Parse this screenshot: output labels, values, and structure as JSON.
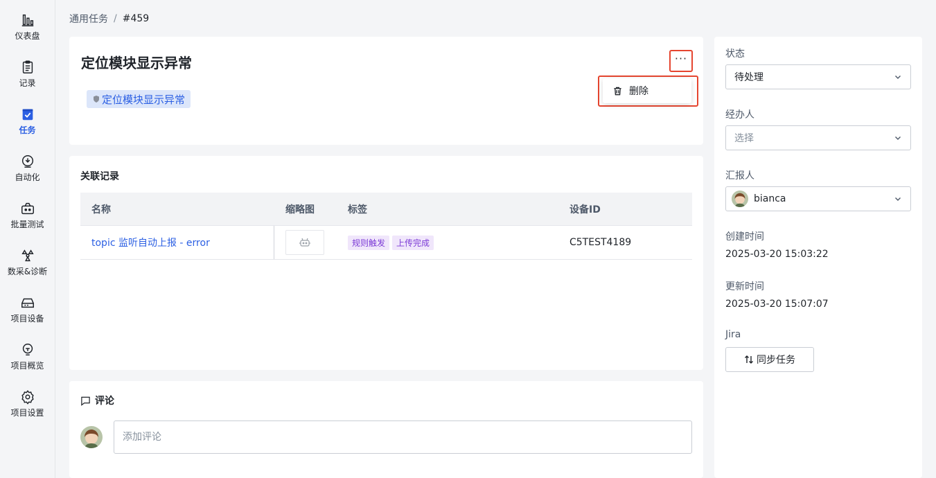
{
  "sidebar": {
    "items": [
      {
        "label": "仪表盘",
        "icon": "bar-chart-icon"
      },
      {
        "label": "记录",
        "icon": "clipboard-icon"
      },
      {
        "label": "任务",
        "icon": "task-check-icon",
        "active": true
      },
      {
        "label": "自动化",
        "icon": "automation-icon"
      },
      {
        "label": "批量测试",
        "icon": "batch-test-icon"
      },
      {
        "label": "数采&诊断",
        "icon": "diagnosis-icon"
      },
      {
        "label": "项目设备",
        "icon": "device-icon"
      },
      {
        "label": "项目概览",
        "icon": "overview-icon"
      },
      {
        "label": "项目设置",
        "icon": "gear-icon"
      }
    ]
  },
  "breadcrumb": {
    "parent": "通用任务",
    "separator": "/",
    "current": "#459"
  },
  "task": {
    "title": "定位模块显示异常",
    "tag_label": "定位模块显示异常",
    "more_label": "···"
  },
  "menu": {
    "delete_label": "删除"
  },
  "records": {
    "section_title": "关联记录",
    "columns": [
      "名称",
      "缩略图",
      "标签",
      "设备ID"
    ],
    "rows": [
      {
        "name": "topic 监听自动上报 - error",
        "tags": [
          "规则触发",
          "上传完成"
        ],
        "device_id": "C5TEST4189"
      }
    ]
  },
  "comments": {
    "title": "评论",
    "placeholder": "添加评论"
  },
  "side": {
    "status_label": "状态",
    "status_value": "待处理",
    "assignee_label": "经办人",
    "assignee_placeholder": "选择",
    "reporter_label": "汇报人",
    "reporter_value": "bianca",
    "created_label": "创建时间",
    "created_value": "2025-03-20 15:03:22",
    "updated_label": "更新时间",
    "updated_value": "2025-03-20 15:07:07",
    "jira_label": "Jira",
    "sync_label": "同步任务"
  },
  "colors": {
    "accent": "#2b5fe3",
    "highlight": "#e5452f",
    "tag_purple": "#7c3bd6"
  }
}
